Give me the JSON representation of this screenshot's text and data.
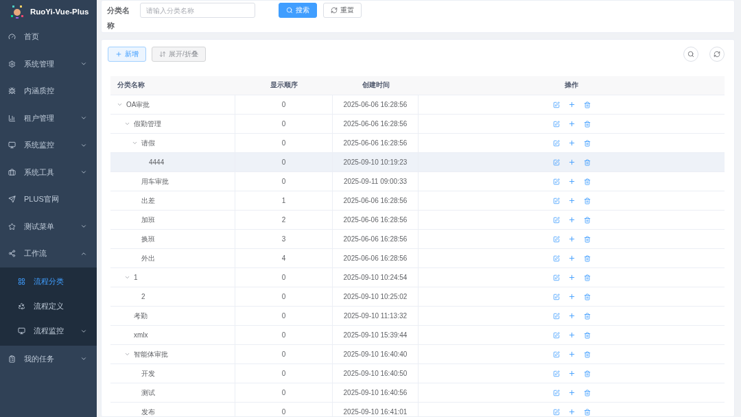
{
  "sidebar": {
    "logo_text": "RuoYi-Vue-Plus",
    "items": [
      {
        "label": "首页"
      },
      {
        "label": "系统管理",
        "expanded": false
      },
      {
        "label": "内涵质控"
      },
      {
        "label": "租户管理",
        "expanded": false
      },
      {
        "label": "系统监控",
        "expanded": false
      },
      {
        "label": "系统工具",
        "expanded": false
      },
      {
        "label": "PLUS官网"
      },
      {
        "label": "测试菜单",
        "expanded": false
      },
      {
        "label": "工作流",
        "expanded": true,
        "children": [
          {
            "label": "流程分类",
            "selected": true
          },
          {
            "label": "流程定义",
            "selected": false
          },
          {
            "label": "流程监控",
            "selected": false,
            "expanded": false
          }
        ]
      },
      {
        "label": "我的任务",
        "expanded": false
      }
    ]
  },
  "search": {
    "label": "分类名称",
    "placeholder": "请输入分类名称",
    "search_button": "搜索",
    "reset_button": "重置"
  },
  "toolbar": {
    "add_button": "新增",
    "toggle_button": "展开/折叠"
  },
  "table": {
    "columns": [
      "分类名称",
      "显示顺序",
      "创建时间",
      "操作"
    ],
    "rows": [
      {
        "name": "OA审批",
        "order": "0",
        "created": "2025-06-06 16:28:56",
        "highlighted": false,
        "expanded": true,
        "children": [
          {
            "name": "假勤管理",
            "order": "0",
            "created": "2025-06-06 16:28:56",
            "highlighted": false,
            "expanded": true,
            "children": [
              {
                "name": "请假",
                "order": "0",
                "created": "2025-06-06 16:28:56",
                "highlighted": false,
                "expanded": true,
                "children": [
                  {
                    "name": "4444",
                    "order": "0",
                    "created": "2025-09-10 10:19:23",
                    "highlighted": true
                  }
                ]
              },
              {
                "name": "用车审批",
                "order": "0",
                "created": "2025-09-11 09:00:33",
                "highlighted": false
              },
              {
                "name": "出差",
                "order": "1",
                "created": "2025-06-06 16:28:56",
                "highlighted": false
              },
              {
                "name": "加班",
                "order": "2",
                "created": "2025-06-06 16:28:56",
                "highlighted": false
              },
              {
                "name": "换班",
                "order": "3",
                "created": "2025-06-06 16:28:56",
                "highlighted": false
              },
              {
                "name": "外出",
                "order": "4",
                "created": "2025-06-06 16:28:56",
                "highlighted": false
              }
            ]
          },
          {
            "name": "1",
            "order": "0",
            "created": "2025-09-10 10:24:54",
            "highlighted": false,
            "expanded": true,
            "children": [
              {
                "name": "2",
                "order": "0",
                "created": "2025-09-10 10:25:02",
                "highlighted": false
              }
            ]
          },
          {
            "name": "考勤",
            "order": "0",
            "created": "2025-09-10 11:13:32",
            "highlighted": false
          },
          {
            "name": "xmlx",
            "order": "0",
            "created": "2025-09-10 15:39:44",
            "highlighted": false
          },
          {
            "name": "智能体审批",
            "order": "0",
            "created": "2025-09-10 16:40:40",
            "highlighted": false,
            "expanded": true,
            "children": [
              {
                "name": "开发",
                "order": "0",
                "created": "2025-09-10 16:40:50",
                "highlighted": false
              },
              {
                "name": "测试",
                "order": "0",
                "created": "2025-09-10 16:40:56",
                "highlighted": false
              },
              {
                "name": "发布",
                "order": "0",
                "created": "2025-09-10 16:41:01",
                "highlighted": false
              }
            ]
          }
        ]
      }
    ]
  }
}
